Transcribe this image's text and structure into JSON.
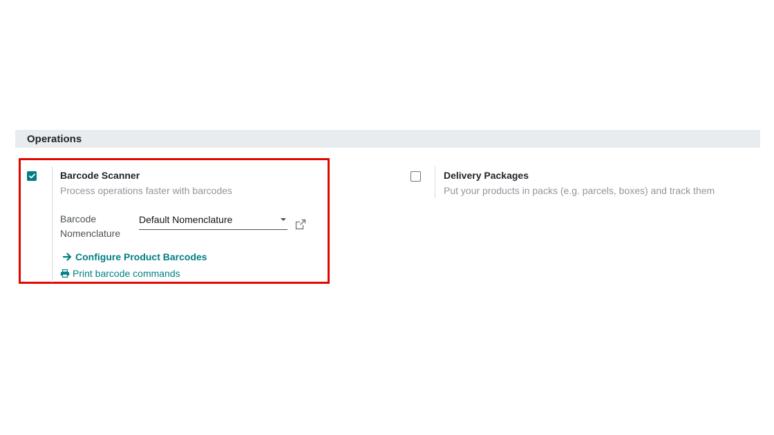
{
  "section": {
    "title": "Operations"
  },
  "barcode_scanner": {
    "checked": true,
    "title": "Barcode Scanner",
    "description": "Process operations faster with barcodes",
    "nomenclature_label_line1": "Barcode",
    "nomenclature_label_line2": "Nomenclature",
    "nomenclature_value": "Default Nomenclature",
    "configure_link": "Configure Product Barcodes",
    "print_link": "Print barcode commands"
  },
  "delivery_packages": {
    "checked": false,
    "title": "Delivery Packages",
    "description": "Put your products in packs (e.g. parcels, boxes) and track them"
  },
  "colors": {
    "accent": "#017e84",
    "highlight_border": "#e10600",
    "section_bg": "#e9ecef",
    "muted_text": "#8f959b"
  },
  "icons": {
    "checkbox_checked": "check-icon",
    "external_link": "external-link-icon",
    "configure": "arrow-right-icon",
    "print": "printer-icon",
    "dropdown": "caret-down-icon"
  }
}
